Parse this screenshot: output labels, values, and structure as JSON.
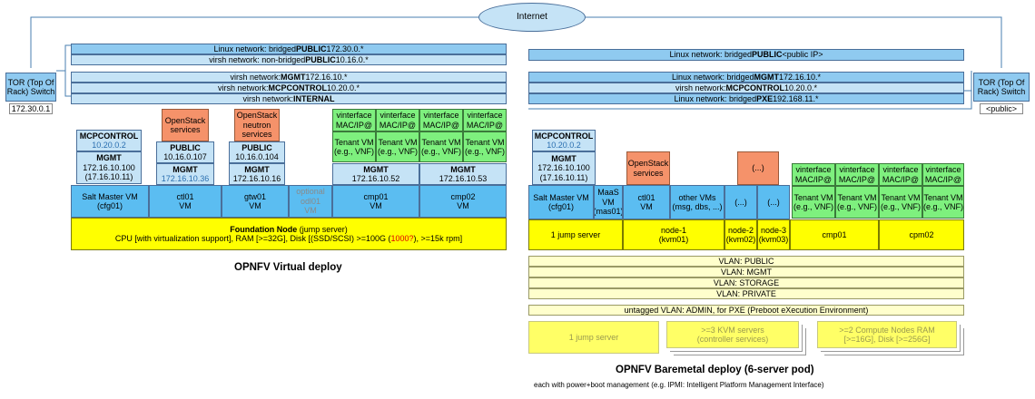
{
  "internet": "Internet",
  "tor_left": {
    "label": "TOR (Top Of Rack) Switch",
    "ip": "172.30.0.1"
  },
  "tor_right": {
    "label": "TOR (Top Of Rack) Switch",
    "ip": "<public>"
  },
  "virtual": {
    "net_public": [
      {
        "pre": "Linux network: bridged ",
        "bold": "PUBLIC",
        "post": " 172.30.0.*"
      },
      {
        "pre": "virsh network: non-bridged ",
        "bold": "PUBLIC",
        "post": " 10.16.0.*"
      }
    ],
    "net_internal": [
      {
        "pre": "virsh network: ",
        "bold": "MGMT",
        "post": " 172.16.10.*"
      },
      {
        "pre": "virsh network: ",
        "bold": "MCPCONTROL",
        "post": " 10.20.0.*"
      },
      {
        "pre": "virsh network: ",
        "bold": "INTERNAL",
        "post": ""
      }
    ],
    "salt": {
      "mcp": "MCPCONTROL",
      "mcp_ip": "10.20.0.2",
      "mgmt": "MGMT",
      "mgmt_ip1": "172.16.10.100",
      "mgmt_ip2": "(17.16.10.11)",
      "vm": "Salt Master VM (cfg01)"
    },
    "ctl": {
      "svc": "OpenStack services",
      "pub": "PUBLIC",
      "pub_ip": "10.16.0.107",
      "mgmt": "MGMT",
      "mgmt_ip": "172.16.10.36",
      "vm1": "ctl01",
      "vm2": "VM"
    },
    "gtw": {
      "svc": "OpenStack neutron services",
      "pub": "PUBLIC",
      "pub_ip": "10.16.0.104",
      "mgmt": "MGMT",
      "mgmt_ip": "172.16.10.16",
      "vm1": "gtw01",
      "vm2": "VM"
    },
    "odl": "optional odl01 VM",
    "vif": "vinterface MAC/IP@",
    "tenant": "Tenant VM (e.g., VNF)",
    "cmp01": {
      "mgmt": "MGMT",
      "ip": "172.16.10.52",
      "vm1": "cmp01",
      "vm2": "VM"
    },
    "cmp02": {
      "mgmt": "MGMT",
      "ip": "172.16.10.53",
      "vm1": "cmp02",
      "vm2": "VM"
    },
    "foundation_title": "Foundation Node",
    "foundation_sub": " (jump server)",
    "cpu_pre": "CPU [with virtualization support], RAM [>=32G], Disk [(SSD/SCSI) >=100G (",
    "cpu_red": "1000?",
    "cpu_post": "), >=15k rpm]",
    "title": "OPNFV Virtual deploy"
  },
  "baremetal": {
    "net_public": {
      "pre": "Linux network: bridged ",
      "bold": "PUBLIC",
      "post": " <public IP>"
    },
    "net_internal": [
      {
        "pre": "Linux network: bridged ",
        "bold": "MGMT",
        "post": " 172.16.10.*"
      },
      {
        "pre": "virsh network: ",
        "bold": "MCPCONTROL",
        "post": " 10.20.0.*"
      },
      {
        "pre": "Linux network: bridged ",
        "bold": "PXE",
        "post": " 192.168.11.*"
      }
    ],
    "salt": {
      "mcp": "MCPCONTROL",
      "mcp_ip": "10.20.0.2",
      "mgmt": "MGMT",
      "mgmt_ip1": "172.16.10.100",
      "mgmt_ip2": "(17.16.10.11)",
      "vm": "Salt Master VM (cfg01)"
    },
    "maas": "MaaS VM (mas01)",
    "svc": "OpenStack services",
    "ctl": "ctl01 VM",
    "other": "other VMs (msg, dbs, ...)",
    "ellipsis": "(...)",
    "vif": "vinterface MAC/IP@",
    "tenant": "Tenant VM (e.g., VNF)",
    "jump": "1 jump server",
    "node1": "node-1 (kvm01)",
    "node2": "node-2 (kvm02)",
    "node3": "node-3 (kvm03)",
    "cmp01": "cmp01",
    "cpm02": "cpm02",
    "vlans": [
      "VLAN: PUBLIC",
      "VLAN: MGMT",
      "VLAN: STORAGE",
      "VLAN: PRIVATE"
    ],
    "untagged": "untagged VLAN: ADMIN, for PXE (Preboot eXecution Environment)",
    "pod_jump": "1 jump server",
    "pod_kvm": ">=3 KVM servers (controller services)",
    "pod_compute": ">=2 Compute Nodes RAM [>=16G], Disk [>=256G]",
    "title": "OPNFV Baremetal deploy (6-server pod)",
    "footnote": "each with power+boot management (e.g. IPMI: Intelligent Platform Management Interface)"
  },
  "colors": {
    "light_blue": "#c5e3f6",
    "mid_blue": "#8fcaf0",
    "vm_blue": "#5bbdf1",
    "yellow": "#ffff00",
    "green": "#7ef07e",
    "orange": "#f5926a"
  }
}
